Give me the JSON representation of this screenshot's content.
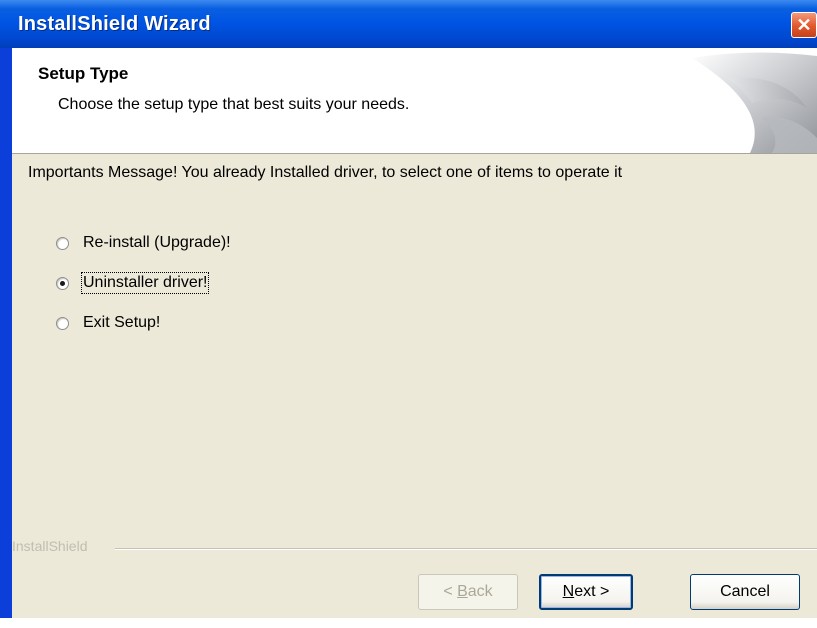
{
  "window": {
    "title": "InstallShield Wizard",
    "close_glyph": "✕",
    "close_icon": "close-icon"
  },
  "header": {
    "title": "Setup Type",
    "subtitle": "Choose the setup type that best suits your needs.",
    "art_icon": "curled-page-graphic"
  },
  "body": {
    "message": "Importants Message! You already Installed driver, to select one of items to operate it",
    "options": [
      {
        "label": "Re-install (Upgrade)!",
        "checked": false
      },
      {
        "label": "Uninstaller driver!",
        "checked": true
      },
      {
        "label": "Exit Setup!",
        "checked": false
      }
    ]
  },
  "footer": {
    "brand": "InstallShield",
    "back": {
      "mnemonic": "B",
      "rest": "ack",
      "prefix": "< ",
      "enabled": false
    },
    "next": {
      "mnemonic": "N",
      "rest": "ext >",
      "enabled": true
    },
    "cancel": {
      "label": "Cancel",
      "enabled": true
    }
  },
  "colors": {
    "titlebar": "#0055e5",
    "dialog_bg": "#ece9d8",
    "close_button": "#e1582b"
  }
}
